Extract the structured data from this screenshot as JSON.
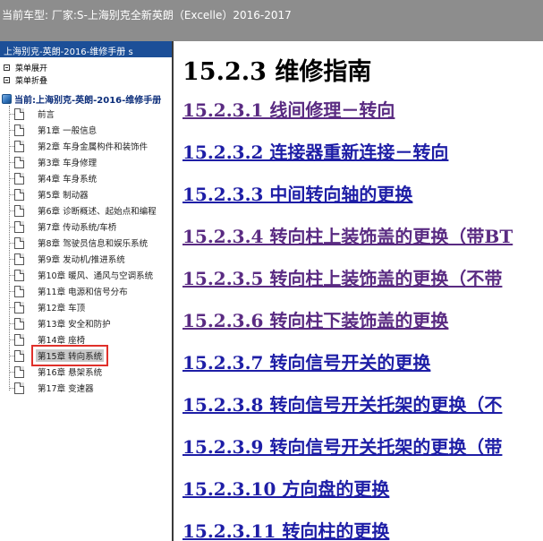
{
  "window": {
    "title": "当前车型:   厂家:S-上海别克全新英朗（Excelle）2016-2017"
  },
  "sidebar": {
    "book_title": "上海别克-英朗-2016-维修手册 s",
    "expand_all": "菜单展开",
    "collapse_all": "菜单折叠",
    "current_label": "当前:上海别克-英朗-2016-维修手册",
    "items": [
      {
        "label": "前言"
      },
      {
        "label": "第1章 一般信息"
      },
      {
        "label": "第2章 车身金属构件和装饰件"
      },
      {
        "label": "第3章 车身修理"
      },
      {
        "label": "第4章 车身系统"
      },
      {
        "label": "第5章 制动器"
      },
      {
        "label": "第6章 诊断概述、起始点和编程"
      },
      {
        "label": "第7章 传动系统/车桥"
      },
      {
        "label": "第8章 驾驶员信息和娱乐系统"
      },
      {
        "label": "第9章 发动机/推进系统"
      },
      {
        "label": "第10章 暖风、通风与空调系统"
      },
      {
        "label": "第11章 电源和信号分布"
      },
      {
        "label": "第12章 车顶"
      },
      {
        "label": "第13章 安全和防护"
      },
      {
        "label": "第14章 座椅"
      },
      {
        "label": "第15章 转向系统"
      },
      {
        "label": "第16章 悬架系统"
      },
      {
        "label": "第17章 变速器"
      }
    ],
    "selected_index": 15
  },
  "main": {
    "title": "15.2.3 维修指南",
    "links": [
      {
        "label": "15.2.3.1 线间修理－转向",
        "visited": true
      },
      {
        "label": "15.2.3.2 连接器重新连接－转向",
        "visited": false
      },
      {
        "label": "15.2.3.3 中间转向轴的更换",
        "visited": false
      },
      {
        "label": "15.2.3.4 转向柱上装饰盖的更换（带BT",
        "visited": true
      },
      {
        "label": "15.2.3.5 转向柱上装饰盖的更换（不带",
        "visited": true
      },
      {
        "label": "15.2.3.6 转向柱下装饰盖的更换",
        "visited": true
      },
      {
        "label": "15.2.3.7 转向信号开关的更换",
        "visited": false
      },
      {
        "label": "15.2.3.8 转向信号开关托架的更换（不",
        "visited": false
      },
      {
        "label": "15.2.3.9 转向信号开关托架的更换（带",
        "visited": false
      },
      {
        "label": "15.2.3.10 方向盘的更换",
        "visited": false
      },
      {
        "label": "15.2.3.11 转向柱的更换",
        "visited": false
      }
    ]
  },
  "colors": {
    "titlebar": "#8d8d8d",
    "book_title_bg": "#1c4f98",
    "link_visited": "#5a2b82",
    "link_unvisited": "#1e1ea6",
    "selection_outline": "#e0302a"
  }
}
